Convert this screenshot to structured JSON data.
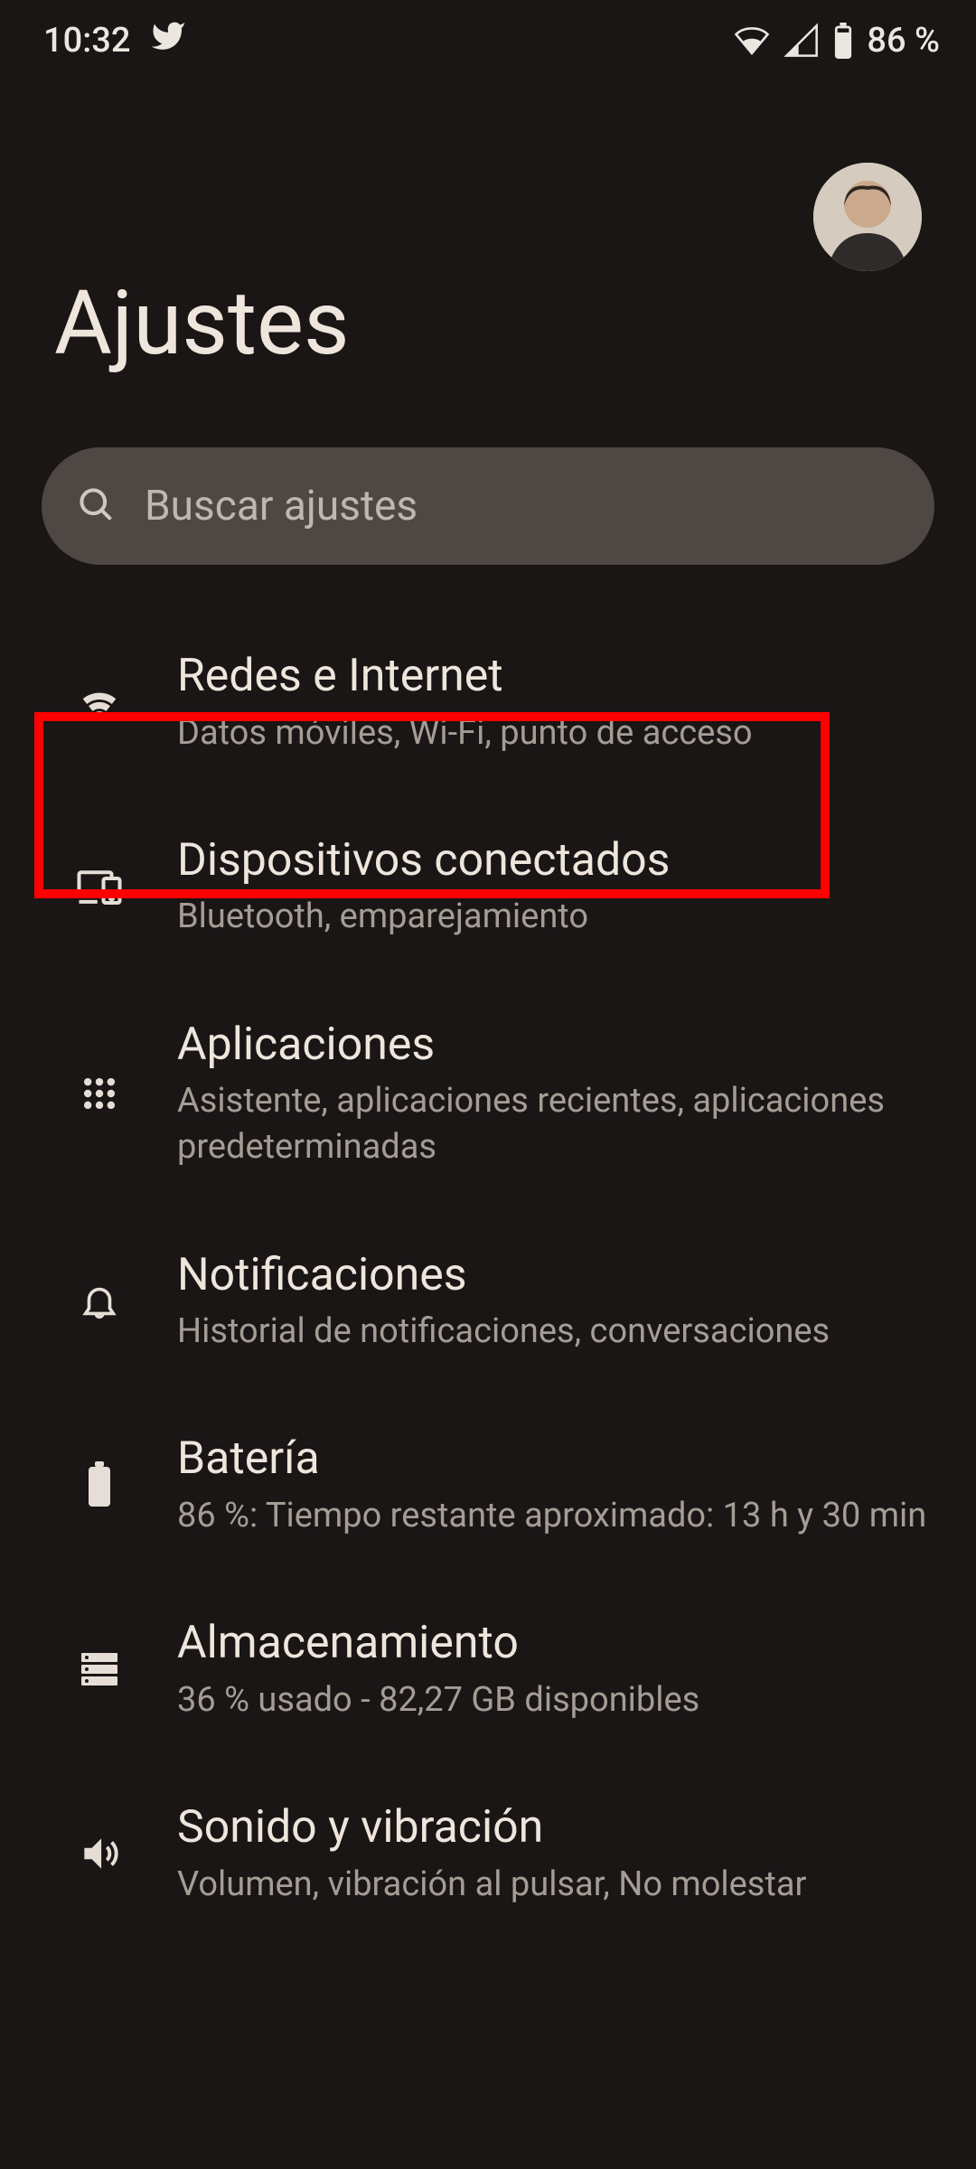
{
  "status_bar": {
    "time": "10:32",
    "battery_text": "86 %"
  },
  "header": {
    "title": "Ajustes"
  },
  "search": {
    "placeholder": "Buscar ajustes"
  },
  "items": [
    {
      "icon": "wifi",
      "title": "Redes e Internet",
      "subtitle": "Datos móviles, Wi-Fi, punto de acceso"
    },
    {
      "icon": "devices",
      "title": "Dispositivos conectados",
      "subtitle": "Bluetooth, emparejamiento"
    },
    {
      "icon": "apps",
      "title": "Aplicaciones",
      "subtitle": "Asistente, aplicaciones recientes, aplicaciones predeterminadas"
    },
    {
      "icon": "bell",
      "title": "Notificaciones",
      "subtitle": "Historial de notificaciones, conversaciones"
    },
    {
      "icon": "battery",
      "title": "Batería",
      "subtitle": "86 %: Tiempo restante aproximado: 13 h y 30 min"
    },
    {
      "icon": "storage",
      "title": "Almacenamiento",
      "subtitle": "36 % usado - 82,27 GB disponibles"
    },
    {
      "icon": "sound",
      "title": "Sonido y vibración",
      "subtitle": "Volumen, vibración al pulsar, No molestar"
    }
  ],
  "highlight": {
    "target_index": 0
  }
}
